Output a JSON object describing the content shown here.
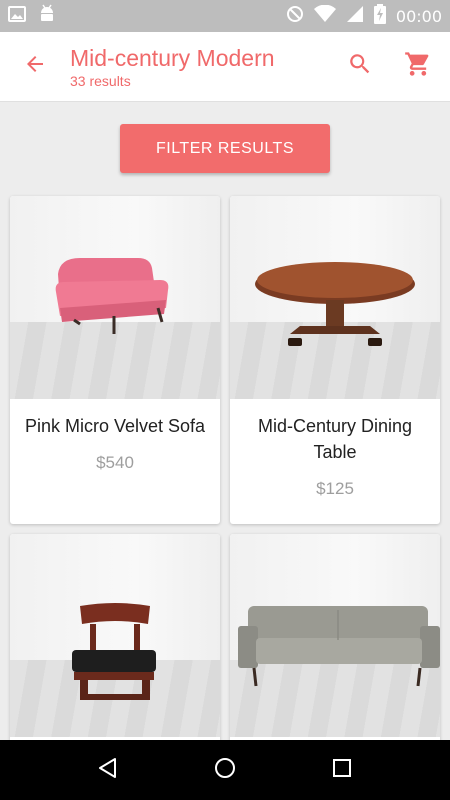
{
  "status_bar": {
    "time": "00:00",
    "icons": [
      "image-icon",
      "android-icon",
      "do-not-disturb-icon",
      "wifi-icon",
      "signal-icon",
      "battery-charging-icon"
    ]
  },
  "app_bar": {
    "title": "Mid-century Modern",
    "subtitle": "33 results",
    "back_icon": "arrow-back-icon",
    "search_icon": "search-icon",
    "cart_icon": "shopping-cart-icon",
    "accent_color": "#f0696a"
  },
  "filter": {
    "label": "FILTER RESULTS",
    "color": "#f26c6c"
  },
  "products": [
    {
      "name": "Pink Micro Velvet Sofa",
      "price": "$540"
    },
    {
      "name": "Mid-Century Dining Table",
      "price": "$125"
    },
    {
      "name": "",
      "price": ""
    },
    {
      "name": "",
      "price": ""
    }
  ],
  "nav_bar": {
    "icons": [
      "back-triangle-icon",
      "home-circle-icon",
      "recents-square-icon"
    ]
  }
}
